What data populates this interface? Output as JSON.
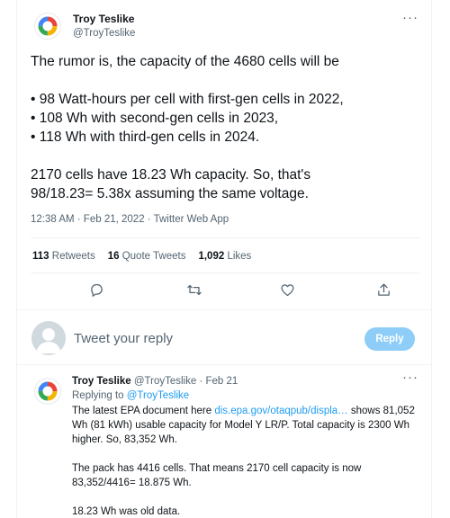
{
  "tweet": {
    "author_name": "Troy Teslike",
    "author_handle": "@TroyTeslike",
    "text_lines": [
      "The rumor is, the capacity of the 4680 cells will be",
      "",
      "• 98 Watt-hours per cell with first-gen cells in 2022,",
      "• 108 Wh with second-gen cells in 2023,",
      "• 118 Wh with third-gen cells in 2024.",
      "",
      "2170 cells have 18.23 Wh capacity. So, that's",
      "98/18.23= 5.38x assuming the same voltage."
    ],
    "timestamp": "12:38 AM · Feb 21, 2022 · Twitter Web App",
    "stats": {
      "retweets_count": "113",
      "retweets_label": "Retweets",
      "quotes_count": "16",
      "quotes_label": "Quote Tweets",
      "likes_count": "1,092",
      "likes_label": "Likes"
    },
    "actions": [
      "reply-icon",
      "retweet-icon",
      "like-icon",
      "share-icon"
    ]
  },
  "reply_composer": {
    "placeholder": "Tweet your reply",
    "button_label": "Reply"
  },
  "reply": {
    "author_name": "Troy Teslike",
    "author_handle": "@TroyTeslike",
    "separator": "·",
    "date": "Feb 21",
    "replying_prefix": "Replying to",
    "replying_handle": "@TroyTeslike",
    "line1_pre": "The latest EPA document here",
    "line1_link": "dis.epa.gov/otaqpub/displa…",
    "line1_post": "shows 81,052",
    "line2": "Wh (81 kWh) usable capacity for Model Y LR/P. Total capacity is 2300 Wh",
    "line3": "higher. So, 83,352 Wh.",
    "line4": "The pack has 4416 cells. That means 2170 cell capacity is now",
    "line5": "83,352/4416= 18.875 Wh.",
    "line6": "18.23 Wh was old data."
  },
  "colors": {
    "accent": "#1d9bf0",
    "reply_button": "#8ecdf8",
    "secondary_text": "#536471",
    "logo_red": "#e8443a",
    "logo_yellow": "#f4b400",
    "logo_green": "#34a853",
    "logo_blue": "#4285f4"
  }
}
